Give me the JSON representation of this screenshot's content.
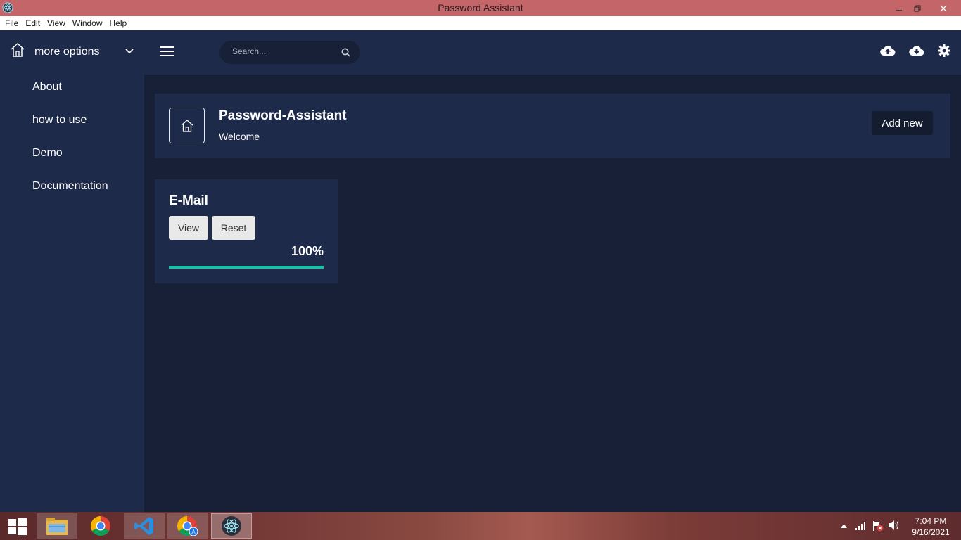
{
  "window": {
    "title": "Password Assistant"
  },
  "menubar": {
    "items": [
      "File",
      "Edit",
      "View",
      "Window",
      "Help"
    ]
  },
  "sidebar": {
    "header_label": "more options",
    "items": [
      {
        "label": "About"
      },
      {
        "label": "how to use"
      },
      {
        "label": "Demo"
      },
      {
        "label": "Documentation"
      }
    ]
  },
  "header": {
    "search": {
      "placeholder": "Search...",
      "value": ""
    },
    "icons": [
      "cloud-upload-icon",
      "cloud-download-icon",
      "gear-icon"
    ]
  },
  "banner": {
    "title": "Password-Assistant",
    "subtitle": "Welcome",
    "add_button": "Add new"
  },
  "cards": [
    {
      "title": "E-Mail",
      "view_button": "View",
      "reset_button": "Reset",
      "progress_label": "100%",
      "progress": 1.0
    }
  ],
  "taskbar": {
    "apps": [
      "file-explorer-icon",
      "chrome-icon",
      "vscode-icon",
      "chrome-profile-icon",
      "electron-icon"
    ],
    "time": "7:04 PM",
    "date": "9/16/2021"
  },
  "colors": {
    "accent": "#1fbfa2",
    "panel": "#1d2a49",
    "background": "#172036",
    "titlebar": "#c46569"
  }
}
